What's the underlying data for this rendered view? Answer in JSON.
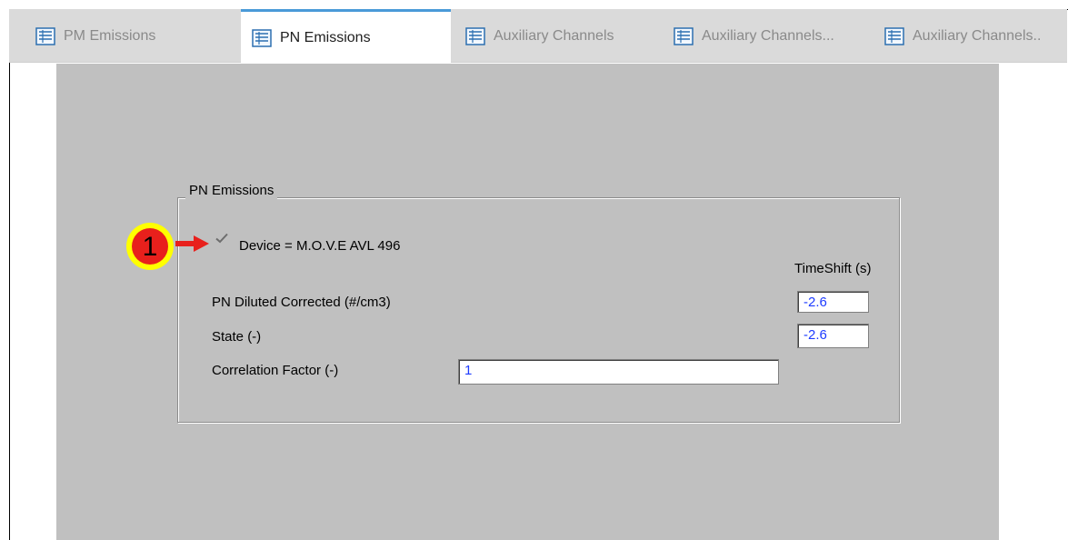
{
  "tabs": [
    {
      "label": "PM Emissions",
      "active": false
    },
    {
      "label": "PN Emissions",
      "active": true
    },
    {
      "label": "Auxiliary Channels",
      "active": false
    },
    {
      "label": "Auxiliary Channels...",
      "active": false
    },
    {
      "label": "Auxiliary Channels..",
      "active": false
    }
  ],
  "group": {
    "title": "PN Emissions",
    "device_label": "Device = M.O.V.E AVL 496",
    "device_checked": true,
    "timeshift_header": "TimeShift (s)",
    "rows": [
      {
        "label": "PN Diluted Corrected (#/cm3)",
        "timeshift": "-2.6"
      },
      {
        "label": "State (-)",
        "timeshift": "-2.6"
      }
    ],
    "correlation_label": "Correlation Factor (-)",
    "correlation_value": "1"
  },
  "callout": {
    "number": "1"
  },
  "colors": {
    "accent": "#4a9ad8",
    "callout_fill": "#e8201c",
    "callout_ring": "#ffff00",
    "value_text": "#1e3cff",
    "pane": "#c0c0c0"
  }
}
